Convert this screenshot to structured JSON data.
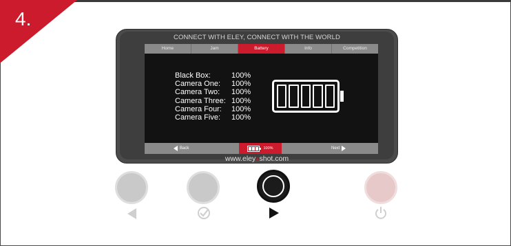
{
  "step": "4.",
  "device": {
    "tagline": "CONNECT WITH ELEY, CONNECT WITH THE WORLD",
    "tabs": [
      {
        "label": "Home",
        "active": false
      },
      {
        "label": "Jam",
        "active": false
      },
      {
        "label": "Battery",
        "active": true
      },
      {
        "label": "Info",
        "active": false
      },
      {
        "label": "Competition",
        "active": false
      }
    ],
    "battery_status": [
      {
        "label": "Black Box:",
        "value": "100%"
      },
      {
        "label": "Camera One:",
        "value": "100%"
      },
      {
        "label": "Camera Two:",
        "value": "100%"
      },
      {
        "label": "Camera Three:",
        "value": "100%"
      },
      {
        "label": "Camera Four:",
        "value": "100%"
      },
      {
        "label": "Camera Five:",
        "value": "100%"
      }
    ],
    "battery_level": 1.0,
    "bottom_bar": {
      "back_label": "Back",
      "status_label": "100%",
      "next_label": "Next"
    },
    "url": {
      "prefix": "www.eley",
      "highlight": "x",
      "suffix": "shot.com"
    }
  },
  "buttons": [
    {
      "name": "back-button",
      "icon": "triangle-left-icon"
    },
    {
      "name": "select-button",
      "icon": "check-circle-icon"
    },
    {
      "name": "next-button",
      "icon": "triangle-right-icon"
    },
    {
      "name": "power-button",
      "icon": "power-icon"
    }
  ],
  "colors": {
    "accent": "#cc1b2c",
    "screen_bg": "#121212",
    "bar_grey": "#8a8a8a"
  }
}
